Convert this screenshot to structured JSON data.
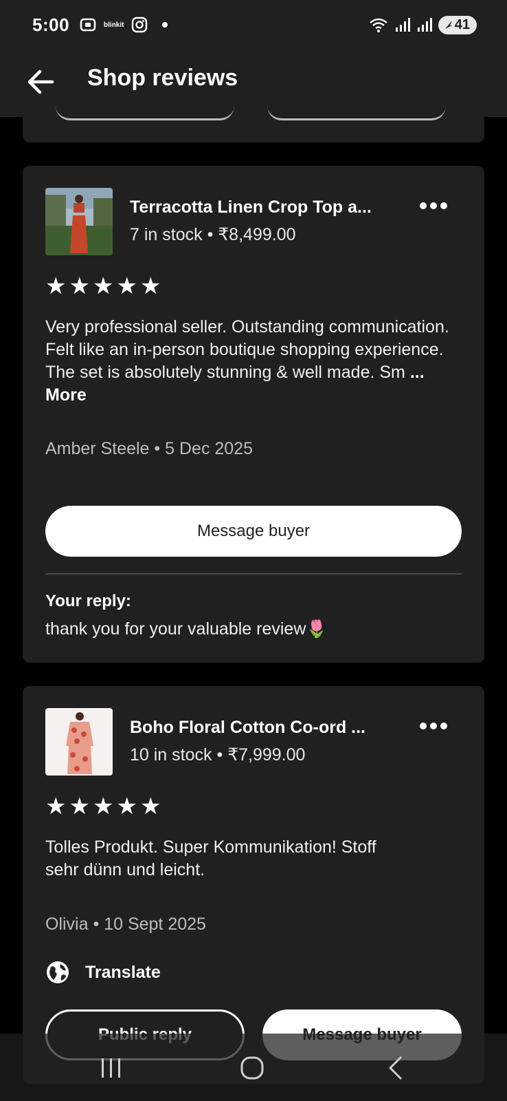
{
  "status_bar": {
    "time": "5:00",
    "notification_icons": [
      "screen-record-icon",
      "blinkit-icon",
      "instagram-icon"
    ],
    "blinkit_label": "blinkit",
    "battery": "41"
  },
  "app_bar": {
    "title": "Shop reviews"
  },
  "reviews": [
    {
      "product_title": "Terracotta Linen Crop Top a...",
      "stock": "7 in stock",
      "price": "₹8,499.00",
      "rating": 5,
      "text": "Very professional seller. Outstanding communication. Felt like an in-person boutique shopping experience. The set is absolutely stunning & well made. Sm",
      "more_label": "... More",
      "reviewer": "Amber Steele",
      "date": "5 Dec 2025",
      "message_button": "Message buyer",
      "reply_label": "Your reply:",
      "reply_text": "thank you  for your valuable review🌷"
    },
    {
      "product_title": "Boho Floral Cotton Co-ord ...",
      "stock": "10 in stock",
      "price": "₹7,999.00",
      "rating": 5,
      "text": "Tolles Produkt. Super Kommunikation! Stoff sehr dünn und leicht.",
      "reviewer": "Olivia",
      "date": "10 Sept 2025",
      "translate_label": "Translate",
      "public_reply_button": "Public reply",
      "message_button": "Message buyer"
    }
  ],
  "separator": "•",
  "colors": {
    "background": "#000000",
    "card": "#202020",
    "text": "#ffffff",
    "muted_text": "#bdbdbd"
  }
}
